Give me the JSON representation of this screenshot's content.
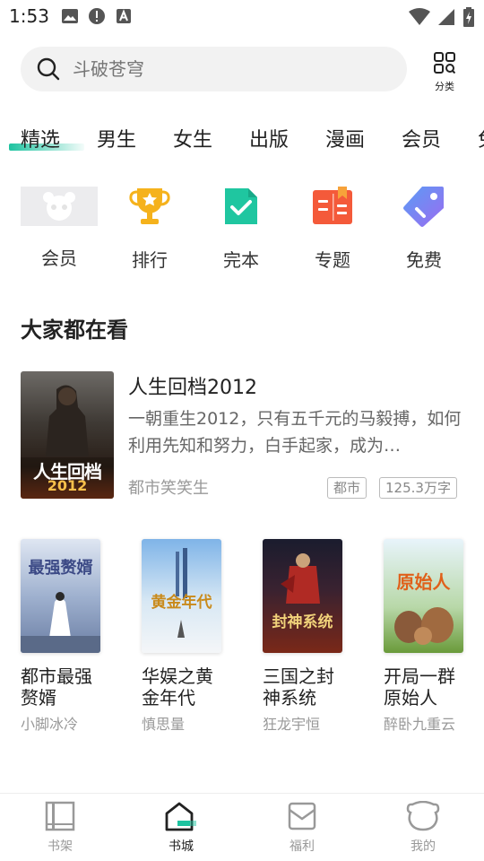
{
  "status": {
    "time": "1:53",
    "icons_left": [
      "image-icon",
      "alert-icon",
      "text-a-icon"
    ],
    "icons_right": [
      "wifi-icon",
      "signal-icon",
      "battery-charging-icon"
    ]
  },
  "search": {
    "placeholder": "斗破苍穹",
    "category_label": "分类"
  },
  "tabs": [
    "精选",
    "男生",
    "女生",
    "出版",
    "漫画",
    "会员",
    "免"
  ],
  "active_tab": "精选",
  "quick_entries": [
    {
      "label": "会员",
      "icon": "panda-avatar-icon"
    },
    {
      "label": "排行",
      "icon": "trophy-icon"
    },
    {
      "label": "完本",
      "icon": "document-check-icon"
    },
    {
      "label": "专题",
      "icon": "open-book-icon"
    },
    {
      "label": "免费",
      "icon": "free-tag-icon"
    }
  ],
  "section": {
    "title": "大家都在看"
  },
  "featured_book": {
    "title": "人生回档2012",
    "description": "一朝重生2012，只有五千元的马毅搏，如何利用先知和努力，白手起家，成为…",
    "author": "都市笑笑生",
    "tags": [
      "都市",
      "125.3万字"
    ],
    "cover_text": "人生回档",
    "cover_year": "2012"
  },
  "book_grid": [
    {
      "title": "都市最强赘婿",
      "author": "小脚冰冷",
      "cover_text": "最强赘婿"
    },
    {
      "title": "华娱之黄金年代",
      "author": "慎思量",
      "cover_text": "黄金年代"
    },
    {
      "title": "三国之封神系统",
      "author": "狂龙宇恒",
      "cover_text": "封神系统"
    },
    {
      "title": "开局一群原始人",
      "author": "醉卧九重云",
      "cover_text": "原始人"
    }
  ],
  "bottom_nav": [
    {
      "label": "书架",
      "icon": "bookshelf-icon"
    },
    {
      "label": "书城",
      "icon": "bookstore-home-icon"
    },
    {
      "label": "福利",
      "icon": "gift-envelope-icon"
    },
    {
      "label": "我的",
      "icon": "bear-profile-icon"
    }
  ],
  "active_nav": "书城",
  "colors": {
    "accent": "#1ec3a0",
    "trophy": "#f5b21c",
    "complete": "#1fc6a0",
    "topic": "#f45a3a",
    "free": "#6a7ff0"
  }
}
